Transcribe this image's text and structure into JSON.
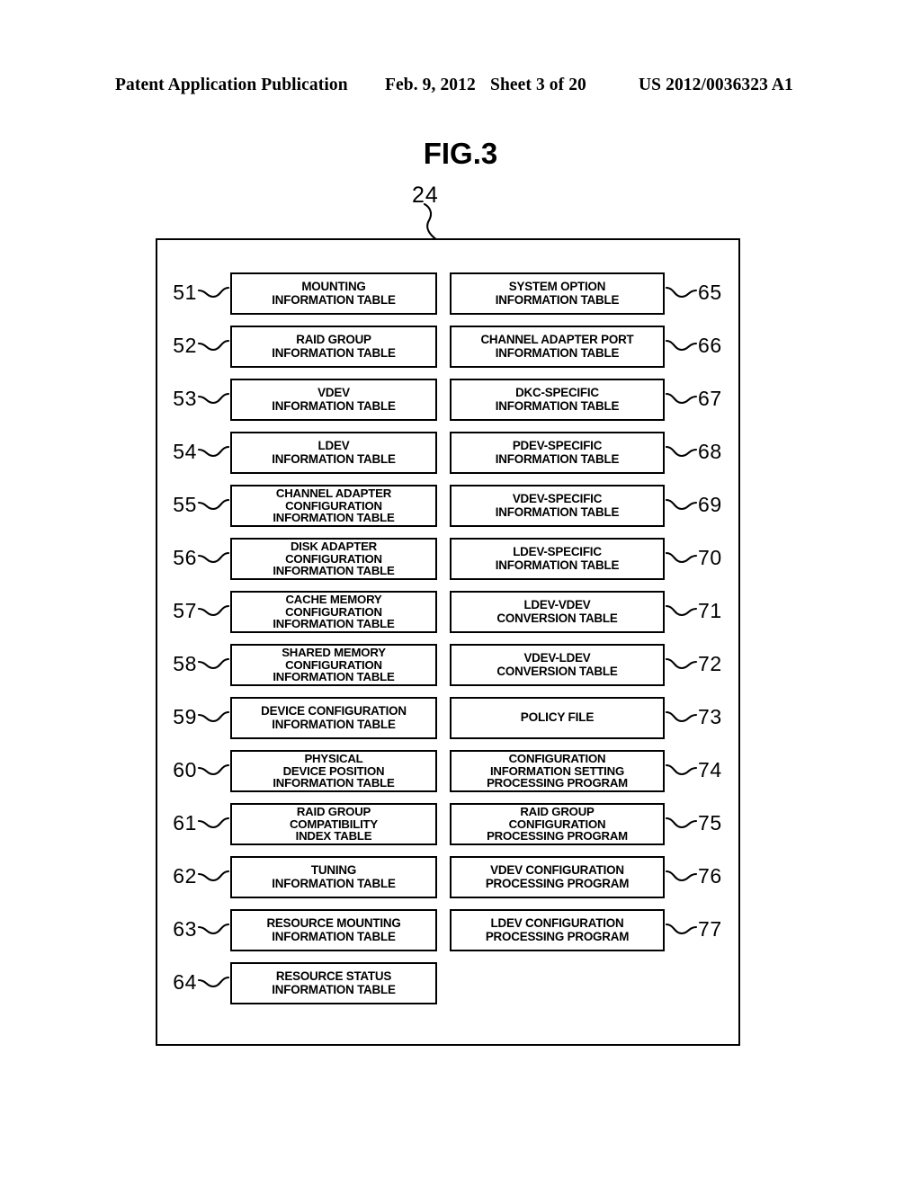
{
  "header": {
    "publication": "Patent Application Publication",
    "date": "Feb. 9, 2012",
    "sheet": "Sheet 3 of 20",
    "patent_number": "US 2012/0036323 A1"
  },
  "figure": {
    "title": "FIG.3",
    "container_ref": "24"
  },
  "colors": {
    "ink": "#000000",
    "paper": "#ffffff"
  },
  "left_column": [
    {
      "ref": "51",
      "label": "MOUNTING\nINFORMATION TABLE",
      "lines": 2
    },
    {
      "ref": "52",
      "label": "RAID GROUP\nINFORMATION TABLE",
      "lines": 2
    },
    {
      "ref": "53",
      "label": "VDEV\nINFORMATION TABLE",
      "lines": 2
    },
    {
      "ref": "54",
      "label": "LDEV\nINFORMATION TABLE",
      "lines": 2
    },
    {
      "ref": "55",
      "label": "CHANNEL ADAPTER\nCONFIGURATION\nINFORMATION TABLE",
      "lines": 3
    },
    {
      "ref": "56",
      "label": "DISK ADAPTER\nCONFIGURATION\nINFORMATION TABLE",
      "lines": 3
    },
    {
      "ref": "57",
      "label": "CACHE MEMORY\nCONFIGURATION\nINFORMATION TABLE",
      "lines": 3
    },
    {
      "ref": "58",
      "label": "SHARED MEMORY\nCONFIGURATION\nINFORMATION TABLE",
      "lines": 3
    },
    {
      "ref": "59",
      "label": "DEVICE CONFIGURATION\nINFORMATION TABLE",
      "lines": 2
    },
    {
      "ref": "60",
      "label": "PHYSICAL\nDEVICE POSITION\nINFORMATION TABLE",
      "lines": 3
    },
    {
      "ref": "61",
      "label": "RAID GROUP\nCOMPATIBILITY\nINDEX TABLE",
      "lines": 3
    },
    {
      "ref": "62",
      "label": "TUNING\nINFORMATION TABLE",
      "lines": 2
    },
    {
      "ref": "63",
      "label": "RESOURCE MOUNTING\nINFORMATION TABLE",
      "lines": 2
    },
    {
      "ref": "64",
      "label": "RESOURCE STATUS\nINFORMATION TABLE",
      "lines": 2
    }
  ],
  "right_column": [
    {
      "ref": "65",
      "label": "SYSTEM OPTION\nINFORMATION TABLE",
      "lines": 2
    },
    {
      "ref": "66",
      "label": "CHANNEL ADAPTER PORT\nINFORMATION TABLE",
      "lines": 2
    },
    {
      "ref": "67",
      "label": "DKC-SPECIFIC\nINFORMATION TABLE",
      "lines": 2
    },
    {
      "ref": "68",
      "label": "PDEV-SPECIFIC\nINFORMATION TABLE",
      "lines": 2
    },
    {
      "ref": "69",
      "label": "VDEV-SPECIFIC\nINFORMATION TABLE",
      "lines": 2
    },
    {
      "ref": "70",
      "label": "LDEV-SPECIFIC\nINFORMATION TABLE",
      "lines": 2
    },
    {
      "ref": "71",
      "label": "LDEV-VDEV\nCONVERSION TABLE",
      "lines": 2
    },
    {
      "ref": "72",
      "label": "VDEV-LDEV\nCONVERSION TABLE",
      "lines": 2
    },
    {
      "ref": "73",
      "label": "POLICY FILE",
      "lines": 1
    },
    {
      "ref": "74",
      "label": "CONFIGURATION\nINFORMATION SETTING\nPROCESSING PROGRAM",
      "lines": 3
    },
    {
      "ref": "75",
      "label": "RAID GROUP\nCONFIGURATION\nPROCESSING PROGRAM",
      "lines": 3
    },
    {
      "ref": "76",
      "label": "VDEV CONFIGURATION\nPROCESSING PROGRAM",
      "lines": 2
    },
    {
      "ref": "77",
      "label": "LDEV CONFIGURATION\nPROCESSING PROGRAM",
      "lines": 2
    }
  ]
}
